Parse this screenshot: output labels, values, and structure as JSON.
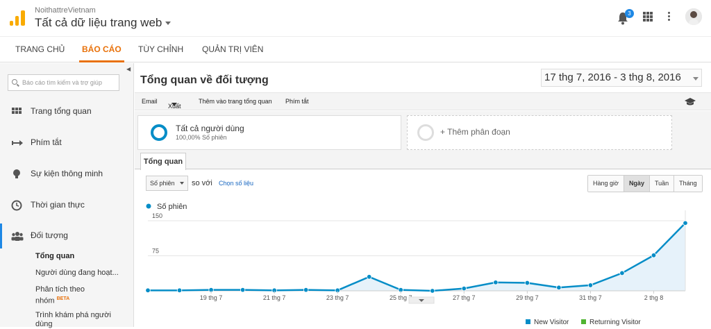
{
  "app": {
    "account": "NoithattreVietnam",
    "property": "Tất cả dữ liệu trang web",
    "notifications": "3"
  },
  "nav": {
    "tabs": [
      "TRANG CHỦ",
      "BÁO CÁO",
      "TÙY CHỈNH",
      "QUẢN TRỊ VIÊN"
    ],
    "active": "BÁO CÁO"
  },
  "sidebar": {
    "search_placeholder": "Báo cáo tìm kiếm và trợ giúp",
    "items": [
      {
        "label": "Trang tổng quan",
        "icon": "dashboard-icon"
      },
      {
        "label": "Phím tắt",
        "icon": "shortcut-icon"
      },
      {
        "label": "Sự kiện thông minh",
        "icon": "lightbulb-icon"
      },
      {
        "label": "Thời gian thực",
        "icon": "clock-icon"
      },
      {
        "label": "Đối tượng",
        "icon": "audience-icon"
      }
    ],
    "subitems": [
      {
        "label": "Tổng quan"
      },
      {
        "label": "Người dùng đang hoạt..."
      },
      {
        "label": "Phân tích theo"
      },
      {
        "label": "nhóm"
      },
      {
        "label": "BETA"
      },
      {
        "label": "Trình khám phá người"
      },
      {
        "label": "dùng"
      }
    ]
  },
  "main": {
    "title": "Tổng quan về đối tượng",
    "date_range": "17 thg 7, 2016 - 3 thg 8, 2016",
    "toolbar": [
      "Email",
      "Xuất",
      "Thêm vào trang tổng quan",
      "Phím tắt"
    ],
    "segment": {
      "name": "Tất cả người dùng",
      "detail": "100,00% Số phiên"
    },
    "add_segment": "+ Thêm phân đoạn",
    "tab": "Tổng quan",
    "metric": "Số phiên",
    "compare_label": "so với",
    "choose_metric": "Chọn số liệu",
    "granularity": [
      "Hàng giờ",
      "Ngày",
      "Tuần",
      "Tháng"
    ],
    "granularity_selected": "Ngày"
  },
  "chart_data": {
    "type": "area",
    "series": [
      {
        "name": "Số phiên",
        "color": "#058dc7",
        "values": [
          1,
          1,
          2,
          2,
          1,
          2,
          1,
          30,
          2,
          0,
          5,
          18,
          17,
          7,
          12,
          38,
          76,
          145
        ]
      }
    ],
    "x": [
      "17 thg 7",
      "18 thg 7",
      "19 thg 7",
      "20 thg 7",
      "21 thg 7",
      "22 thg 7",
      "23 thg 7",
      "24 thg 7",
      "25 thg 7",
      "26 thg 7",
      "27 thg 7",
      "28 thg 7",
      "29 thg 7",
      "30 thg 7",
      "31 thg 7",
      "1 thg 8",
      "2 thg 8",
      "3 thg 8"
    ],
    "x_tick_labels": [
      "19 thg 7",
      "21 thg 7",
      "23 thg 7",
      "25 thg 7",
      "27 thg 7",
      "29 thg 7",
      "31 thg 7",
      "2 thg 8"
    ],
    "y_ticks": [
      "150",
      "75"
    ],
    "ylim": [
      0,
      150
    ],
    "legend": "top-left",
    "grid": true
  },
  "legend_bottom": [
    {
      "label": "New Visitor",
      "color": "#058dc7"
    },
    {
      "label": "Returning Visitor",
      "color": "#50b432"
    }
  ]
}
